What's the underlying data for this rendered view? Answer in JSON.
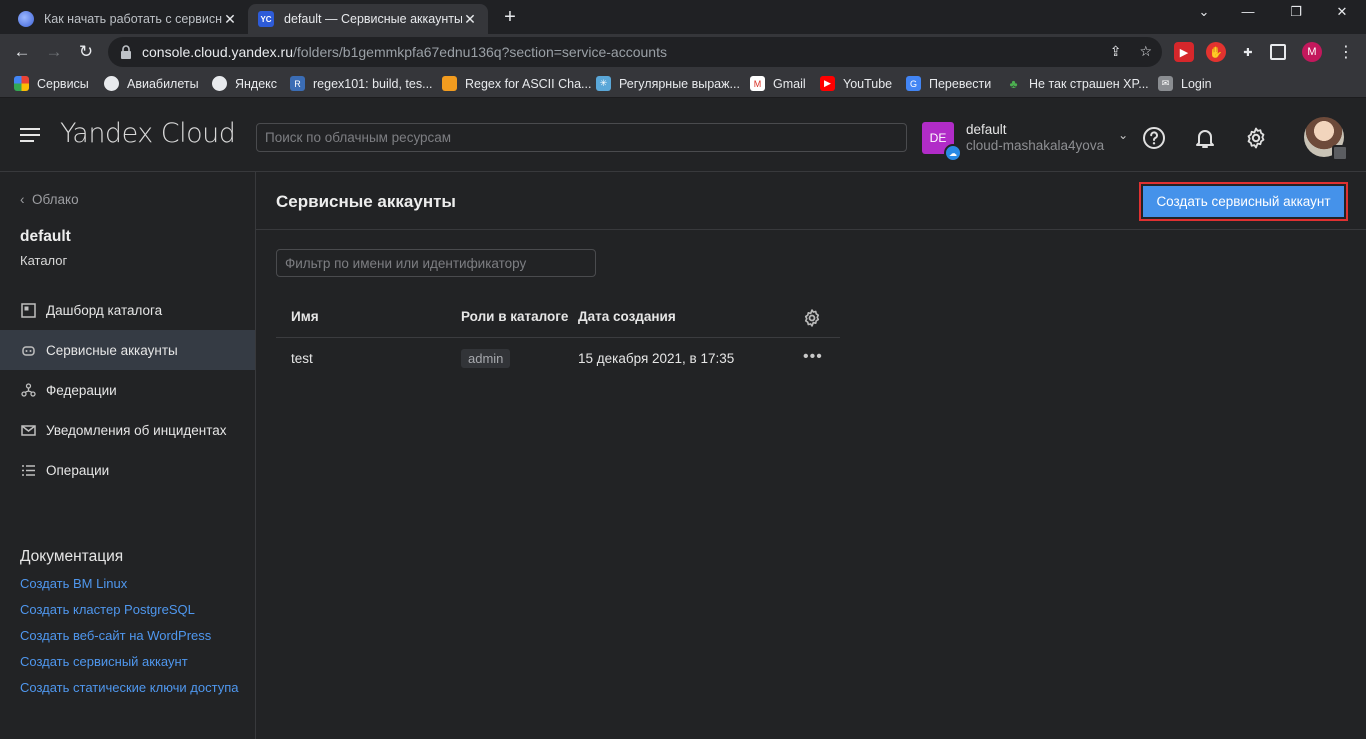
{
  "browser": {
    "tabs": [
      {
        "title": "Как начать работать с сервисны",
        "active": false
      },
      {
        "title": "default — Сервисные аккаунты",
        "active": true
      }
    ],
    "favicon_text": "YC",
    "url_host": "console.cloud.yandex.ru",
    "url_path": "/folders/b1gemmkpfa67ednu136q?section=service-accounts",
    "profile_letter": "M",
    "bookmarks": [
      {
        "label": "Сервисы",
        "icon": "apps-icon"
      },
      {
        "label": "Авиабилеты",
        "icon": "globe-icon"
      },
      {
        "label": "Яндекс",
        "icon": "globe-icon"
      },
      {
        "label": "regex101: build, tes...",
        "icon": "regex101-icon"
      },
      {
        "label": "Regex for ASCII Cha...",
        "icon": "orange-square-icon"
      },
      {
        "label": "Регулярные выраж...",
        "icon": "snowflake-icon"
      },
      {
        "label": "Gmail",
        "icon": "gmail-icon"
      },
      {
        "label": "YouTube",
        "icon": "youtube-icon"
      },
      {
        "label": "Перевести",
        "icon": "translate-icon"
      },
      {
        "label": "Не так страшен XP...",
        "icon": "tree-icon"
      },
      {
        "label": "Login",
        "icon": "mail-icon"
      }
    ],
    "regex101_letter": "R"
  },
  "header": {
    "logo": "Yandex Cloud",
    "search_placeholder": "Поиск по облачным ресурсам",
    "account": {
      "initials": "DE",
      "folder": "default",
      "cloud": "cloud-mashakala4yova"
    }
  },
  "sidebar": {
    "back_label": "Облако",
    "folder_name": "default",
    "folder_type": "Каталог",
    "items": [
      {
        "label": "Дашборд каталога",
        "icon": "dashboard-icon",
        "active": false
      },
      {
        "label": "Сервисные аккаунты",
        "icon": "robot-icon",
        "active": true
      },
      {
        "label": "Федерации",
        "icon": "federation-icon",
        "active": false
      },
      {
        "label": "Уведомления об инцидентах",
        "icon": "envelope-icon",
        "active": false
      },
      {
        "label": "Операции",
        "icon": "list-icon",
        "active": false
      }
    ],
    "docs_title": "Документация",
    "docs": [
      "Создать ВМ Linux",
      "Создать кластер PostgreSQL",
      "Создать веб-сайт на WordPress",
      "Создать сервисный аккаунт",
      "Создать статические ключи доступа"
    ]
  },
  "main": {
    "title": "Сервисные аккаунты",
    "create_button": "Создать сервисный аккаунт",
    "filter_placeholder": "Фильтр по имени или идентификатору",
    "columns": [
      "Имя",
      "Роли в каталоге",
      "Дата создания"
    ],
    "rows": [
      {
        "name": "test",
        "role": "admin",
        "created": "15 декабря 2021, в 17:35"
      }
    ]
  },
  "colors": {
    "accent": "#4592ea",
    "highlight": "#e03131",
    "link": "#4f97ee",
    "avatar": "#b12cc8"
  }
}
